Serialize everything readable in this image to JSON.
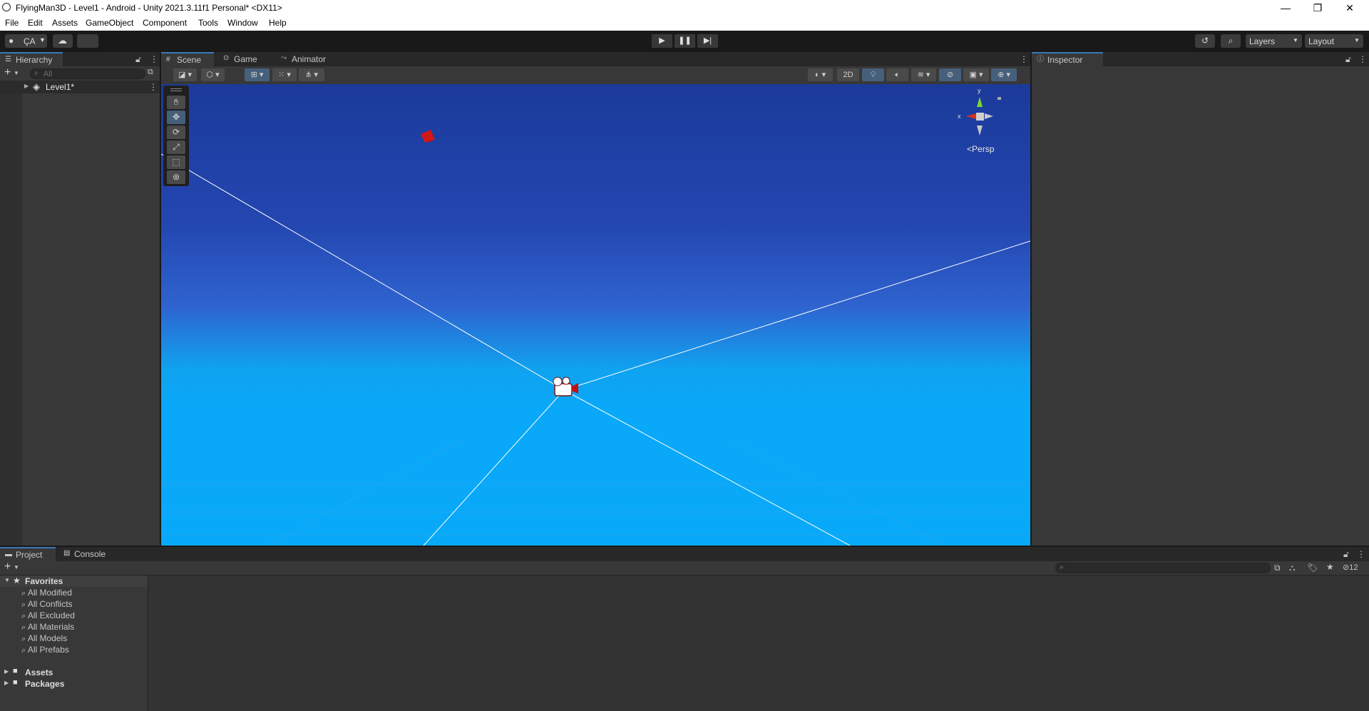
{
  "window": {
    "title": "FlyingMan3D - Level1 - Android - Unity 2021.3.11f1 Personal* <DX11>",
    "minimize_glyph": "—",
    "restore_glyph": "❐",
    "close_glyph": "✕"
  },
  "menu": [
    "File",
    "Edit",
    "Assets",
    "GameObject",
    "Component",
    "Tools",
    "Window",
    "Help"
  ],
  "toolbar": {
    "account_label": "ÇA",
    "layers_label": "Layers",
    "layout_label": "Layout"
  },
  "hierarchy": {
    "tab_label": "Hierarchy",
    "search_placeholder": "All",
    "scene_item": "Level1*"
  },
  "center_tabs": [
    {
      "label": "Scene",
      "icon": "scene-icon"
    },
    {
      "label": "Game",
      "icon": "game-icon"
    },
    {
      "label": "Animator",
      "icon": "animator-icon"
    }
  ],
  "scene": {
    "toggle_2d_label": "2D",
    "gizmo_projection_label": "Persp",
    "gizmo_axes": {
      "y": "y",
      "x": "x"
    }
  },
  "inspector": {
    "tab_label": "Inspector"
  },
  "project": {
    "tabs": [
      {
        "label": "Project",
        "icon": "folder-icon"
      },
      {
        "label": "Console",
        "icon": "console-icon"
      }
    ],
    "favorites_label": "Favorites",
    "favorites": [
      "All Modified",
      "All Conflicts",
      "All Excluded",
      "All Materials",
      "All Models",
      "All Prefabs"
    ],
    "roots": [
      "Assets",
      "Packages"
    ],
    "hidden_count": "12"
  },
  "colors": {
    "accent_blue": "#3a79bb",
    "panel_bg": "#383838",
    "toolbar_bg": "#191919",
    "sky_top": "#1b3a9a",
    "sky_bottom": "#08a9f8"
  }
}
